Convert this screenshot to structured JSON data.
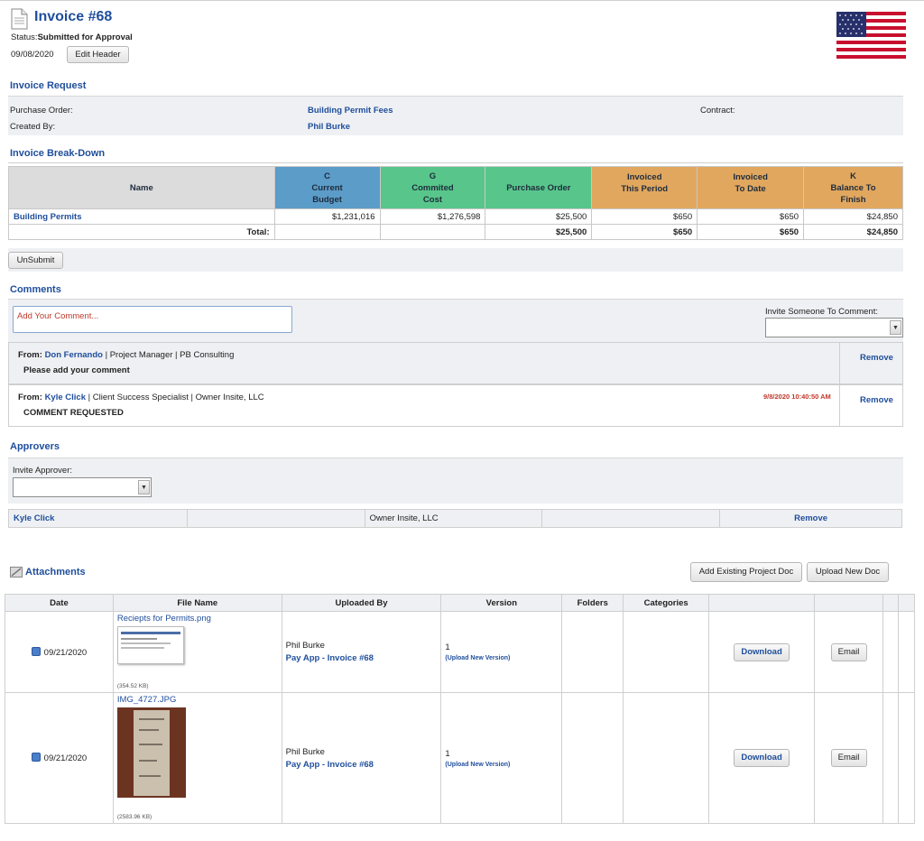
{
  "header": {
    "title": "Invoice #68",
    "status_label": "Status:",
    "status_value": "Submitted for Approval",
    "date": "09/08/2020",
    "edit_button": "Edit Header"
  },
  "request": {
    "title": "Invoice Request",
    "po_label": "Purchase Order:",
    "po_value": "Building Permit Fees",
    "contract_label": "Contract:",
    "created_label": "Created By:",
    "created_value": "Phil Burke"
  },
  "breakdown": {
    "title": "Invoice Break-Down",
    "headers": {
      "name": "Name",
      "c": [
        "C",
        "Current",
        "Budget"
      ],
      "g": [
        "G",
        "Commited",
        "Cost"
      ],
      "po": "Purchase Order",
      "ip": [
        "Invoiced",
        "This Period"
      ],
      "itd": [
        "Invoiced",
        "To Date"
      ],
      "k": [
        "K",
        "Balance To",
        "Finish"
      ]
    },
    "row": {
      "name": "Building Permits",
      "c": "$1,231,016",
      "g": "$1,276,598",
      "po": "$25,500",
      "ip": "$650",
      "itd": "$650",
      "k": "$24,850"
    },
    "total": {
      "label": "Total:",
      "po": "$25,500",
      "ip": "$650",
      "itd": "$650",
      "k": "$24,850"
    },
    "unsubmit_button": "UnSubmit"
  },
  "comments": {
    "title": "Comments",
    "placeholder": "Add Your Comment...",
    "invite_label": "Invite Someone To Comment:",
    "items": [
      {
        "from_label": "From:",
        "name": "Don Fernando",
        "details": " | Project Manager | PB Consulting",
        "text": "Please add your comment",
        "timestamp": "",
        "remove": "Remove"
      },
      {
        "from_label": "From:",
        "name": "Kyle Click",
        "details": " | Client Success Specialist | Owner Insite, LLC",
        "text": "COMMENT REQUESTED",
        "timestamp": "9/8/2020 10:40:50 AM",
        "remove": "Remove"
      }
    ]
  },
  "approvers": {
    "title": "Approvers",
    "invite_label": "Invite Approver:",
    "row": {
      "name": "Kyle Click",
      "company": "Owner Insite, LLC",
      "remove": "Remove"
    }
  },
  "attachments": {
    "title": "Attachments",
    "add_existing_button": "Add Existing Project Doc",
    "upload_new_button": "Upload New Doc",
    "columns": [
      "Date",
      "File Name",
      "Uploaded By",
      "Version",
      "Folders",
      "Categories"
    ],
    "rows": [
      {
        "date": "09/21/2020",
        "file": "Reciepts for Permits.png",
        "size": "(354.52 KB)",
        "uploader": "Phil Burke",
        "pay_app": "Pay App - Invoice #68",
        "version": "1",
        "upload_version": "(Upload New Version)",
        "download": "Download",
        "email": "Email"
      },
      {
        "date": "09/21/2020",
        "file": "IMG_4727.JPG",
        "size": "(2583.96 KB)",
        "uploader": "Phil Burke",
        "pay_app": "Pay App - Invoice #68",
        "version": "1",
        "upload_version": "(Upload New Version)",
        "download": "Download",
        "email": "Email"
      }
    ]
  }
}
